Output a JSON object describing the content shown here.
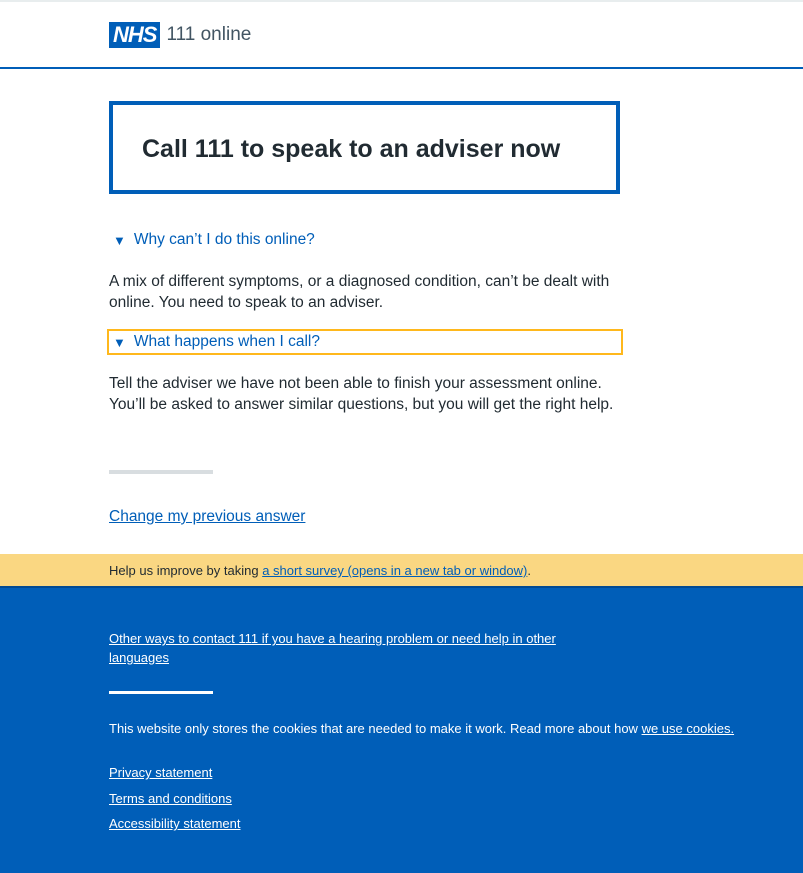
{
  "header": {
    "logo_text": "NHS",
    "service_name": "111 online"
  },
  "callout": {
    "title": "Call 111 to speak to an adviser now"
  },
  "details": [
    {
      "summary": "Why can’t I do this online?",
      "text": "A mix of different symptoms, or a diagnosed condition, can’t be dealt with online. You need to speak to an adviser."
    },
    {
      "summary": "What happens when I call?",
      "text": "Tell the adviser we have not been able to finish your assessment online. You’ll be asked to answer similar questions, but you will get the right help."
    }
  ],
  "change_answer_link": "Change my previous answer",
  "survey": {
    "prefix": "Help us improve by taking ",
    "link": "a short survey (opens in a new tab or window)",
    "suffix": "."
  },
  "footer": {
    "contact_link": "Other ways to contact 111 if you have a hearing problem or need help in other languages",
    "cookies_text": "This website only stores the cookies that are needed to make it work. Read more about how ",
    "cookies_link": "we use cookies.",
    "links": [
      "Privacy statement",
      "Terms and conditions",
      "Accessibility statement"
    ]
  },
  "colors": {
    "nhs_blue": "#005eb8",
    "focus_yellow": "#ffb81c",
    "survey_bg": "#fad782"
  },
  "icons": {
    "expanded": "triangle-down-icon"
  }
}
